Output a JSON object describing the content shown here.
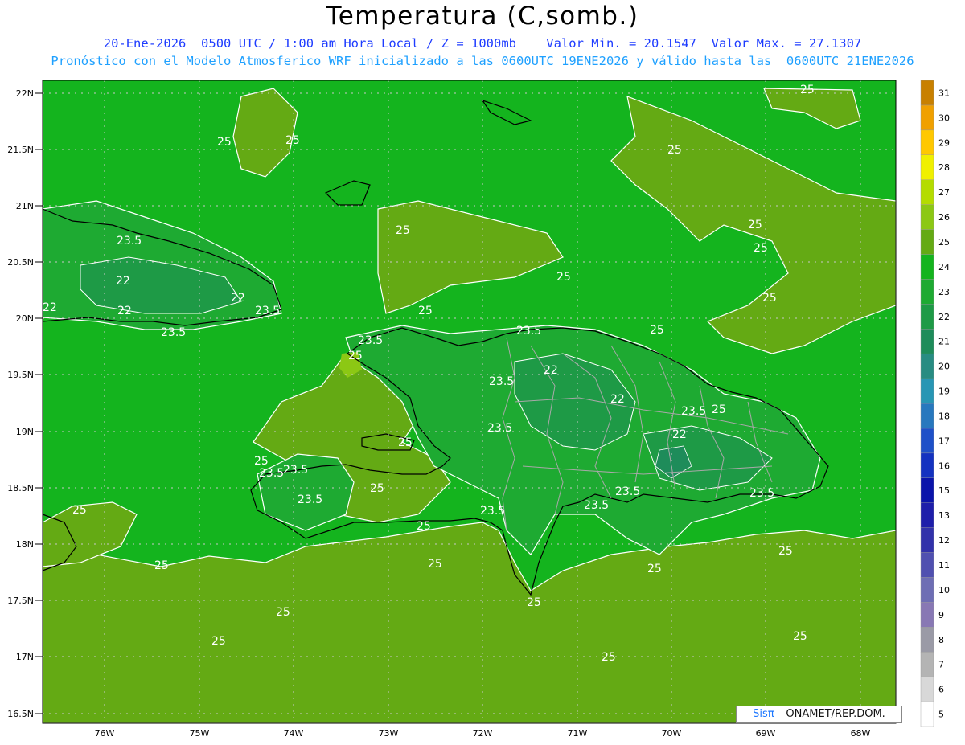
{
  "header": {
    "title": "Temperatura (C,somb.)",
    "subtitle1": "20-Ene-2026  0500 UTC / 1:00 am Hora Local / Z = 1000mb    Valor Min. = 20.1547  Valor Max. = 27.1307",
    "subtitle2": "Pronóstico con el Modelo Atmosferico WRF inicializado a las 0600UTC_19ENE2026 y válido hasta las  0600UTC_21ENE2026"
  },
  "axes": {
    "lat_labels": [
      "22N",
      "21.5N",
      "21N",
      "20.5N",
      "20N",
      "19.5N",
      "19N",
      "18.5N",
      "18N",
      "17.5N",
      "17N",
      "16.5N"
    ],
    "lon_labels": [
      "76W",
      "75W",
      "74W",
      "73W",
      "72W",
      "71W",
      "70W",
      "69W",
      "68W"
    ]
  },
  "colorbar": {
    "levels": [
      "5",
      "6",
      "7",
      "8",
      "9",
      "10",
      "11",
      "12",
      "13",
      "15",
      "16",
      "17",
      "18",
      "19",
      "20",
      "21",
      "22",
      "23",
      "24",
      "25",
      "26",
      "27",
      "28",
      "29",
      "30",
      "31"
    ],
    "colors": [
      "#ffffff",
      "#d8d8d8",
      "#b4b4b4",
      "#9a9aa6",
      "#8878b4",
      "#6e6eb4",
      "#5050b0",
      "#3232aa",
      "#1e1eaa",
      "#0a14aa",
      "#1432c0",
      "#1e50c8",
      "#2878be",
      "#2896b4",
      "#288c82",
      "#1e8c5a",
      "#1e9a46",
      "#1eaa32",
      "#14b41e",
      "#64aa14",
      "#8cc814",
      "#b4dc00",
      "#f0f000",
      "#ffc800",
      "#f0a000",
      "#c88000"
    ],
    "label_values": [
      "31",
      "30",
      "29",
      "28",
      "27",
      "26",
      "25",
      "24",
      "23",
      "22",
      "21",
      "20",
      "19",
      "18",
      "17",
      "16",
      "15",
      "13",
      "12",
      "11",
      "10",
      "9",
      "8",
      "7",
      "6",
      "5"
    ]
  },
  "contour_labels": [
    "25",
    "23.5",
    "22"
  ],
  "credit": {
    "sis": "Sisπ",
    "rest": "– ONAMET/REP.DOM."
  }
}
